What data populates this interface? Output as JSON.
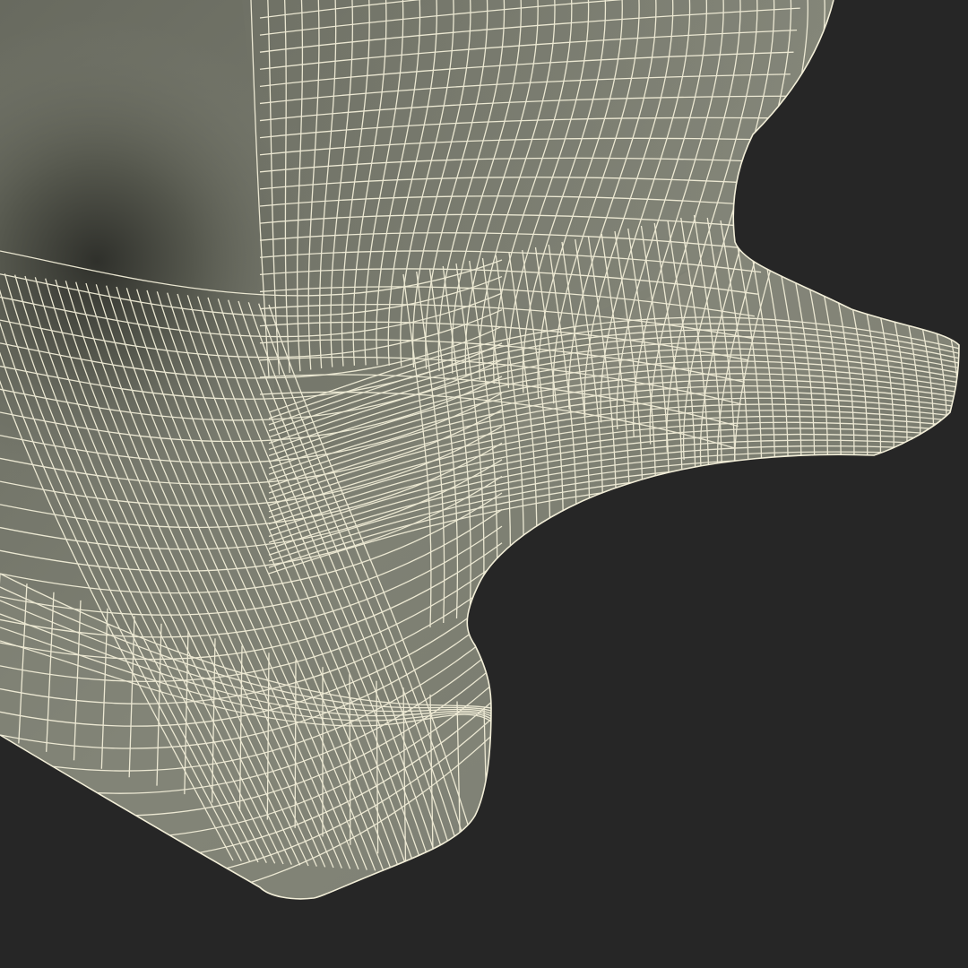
{
  "scene": {
    "background_color": "#262626",
    "surface_color": "#7d7f72",
    "surface_highlight": "#8a8c7f",
    "surface_shadow": "#5e6055",
    "wire_color": "#f2eed8",
    "icon": "wireframe-mesh-icon"
  }
}
